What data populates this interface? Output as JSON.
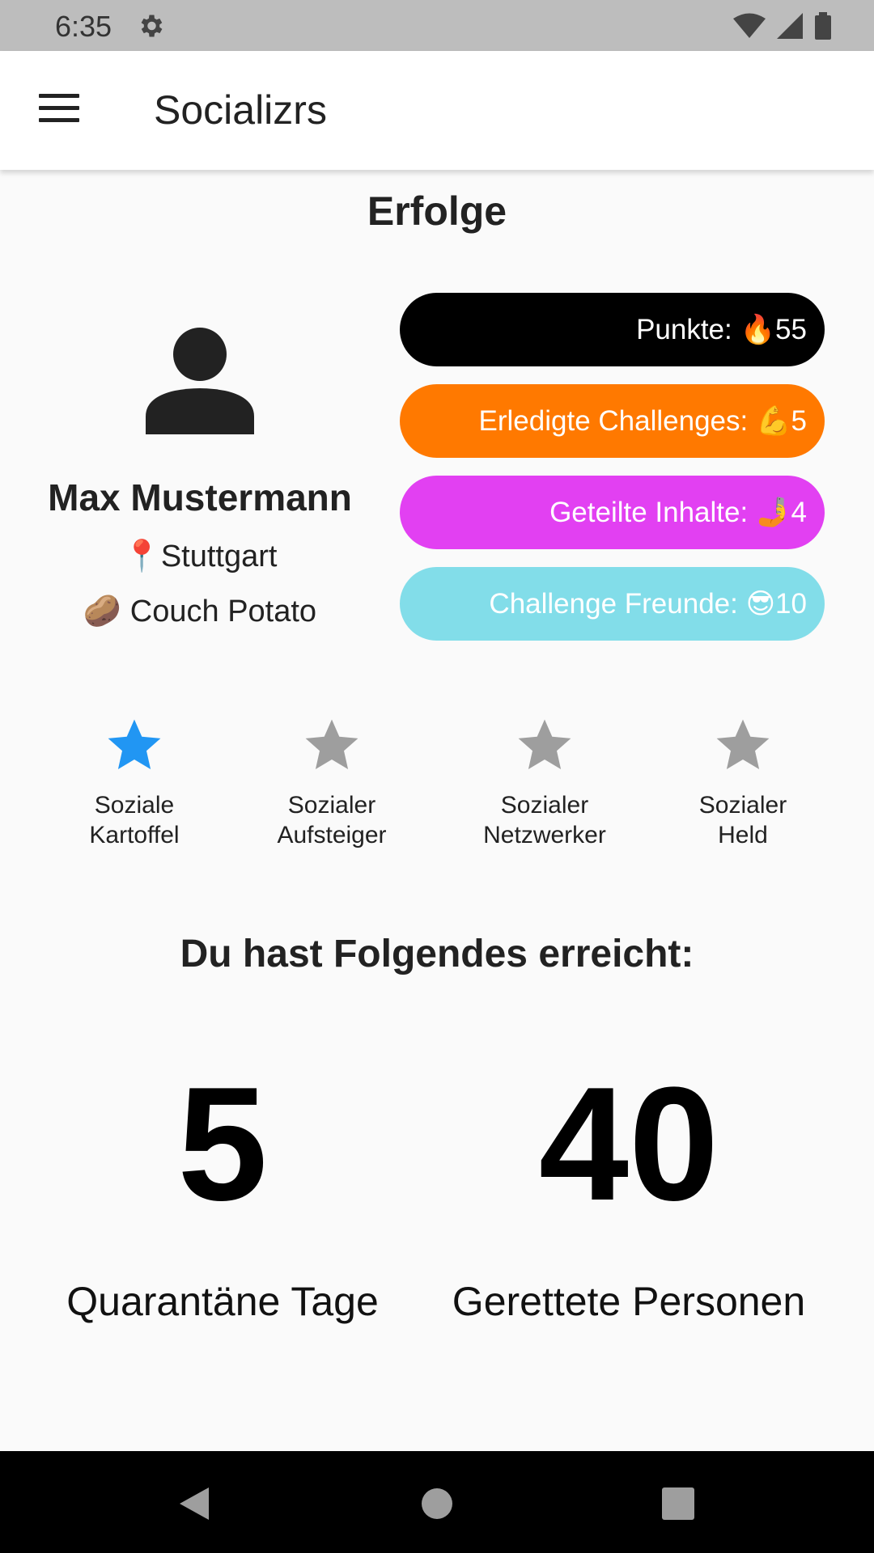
{
  "status_bar": {
    "time": "6:35",
    "icons": [
      "gear-icon",
      "wifi-icon",
      "signal-icon",
      "battery-icon"
    ]
  },
  "app_bar": {
    "title": "Socializrs",
    "menu_icon": "menu-icon"
  },
  "page": {
    "title": "Erfolge"
  },
  "profile": {
    "avatar_icon": "person-icon",
    "name": "Max Mustermann",
    "city": "📍Stuttgart",
    "status": "🥔 Couch Potato"
  },
  "stats": [
    {
      "label": "Punkte: 🔥55",
      "color": "#000000"
    },
    {
      "label": "Erledigte Challenges: 💪5",
      "color": "#ff7900"
    },
    {
      "label": "Geteilte Inhalte: 🤳4",
      "color": "#e240f2"
    },
    {
      "label": "Challenge Freunde: 😎10",
      "color": "#82dde9"
    }
  ],
  "badges": [
    {
      "label": "Soziale\n Kartoffel",
      "active": true,
      "icon": "star-icon"
    },
    {
      "label": "Sozialer\n Aufsteiger",
      "active": false,
      "icon": "star-icon"
    },
    {
      "label": "Sozialer\n Netzwerker",
      "active": false,
      "icon": "star-icon"
    },
    {
      "label": "Sozialer\nHeld",
      "active": false,
      "icon": "star-icon"
    }
  ],
  "achievements": {
    "title": "Du hast Folgendes erreicht:",
    "items": [
      {
        "value": "5",
        "label": "Quarantäne Tage"
      },
      {
        "value": "40",
        "label": "Gerettete Personen"
      }
    ]
  },
  "colors": {
    "star_active": "#2196f3",
    "star_inactive": "#9e9e9e",
    "status_bar": "#bdbdbd",
    "nav_bar": "#000000"
  },
  "nav_bar": {
    "icons": [
      "back-icon",
      "home-icon",
      "recents-icon"
    ]
  }
}
